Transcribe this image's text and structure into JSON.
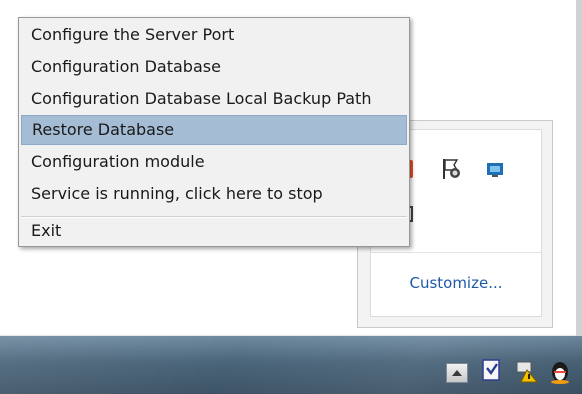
{
  "context_menu": {
    "items": [
      {
        "label": "Configure the Server Port"
      },
      {
        "label": "Configuration Database"
      },
      {
        "label": "Configuration Database Local Backup Path"
      },
      {
        "label": "Restore Database",
        "highlighted": true
      },
      {
        "label": "Configuration module"
      },
      {
        "label": "Service is running, click here to stop"
      }
    ],
    "exit_label": "Exit"
  },
  "tray_flyout": {
    "icons": [
      "app-red-icon",
      "security-flag-icon",
      "network-icon",
      "hidden-device-icon"
    ],
    "customize_label": "Customize..."
  },
  "taskbar": {
    "icons": [
      "show-hidden-icons-chevron",
      "document-check-icon",
      "network-warning-icon",
      "qq-penguin-icon"
    ]
  },
  "colors": {
    "menu_highlight": "#a4bcd4",
    "link": "#1e5aa8",
    "taskbar": "#4a6479"
  }
}
